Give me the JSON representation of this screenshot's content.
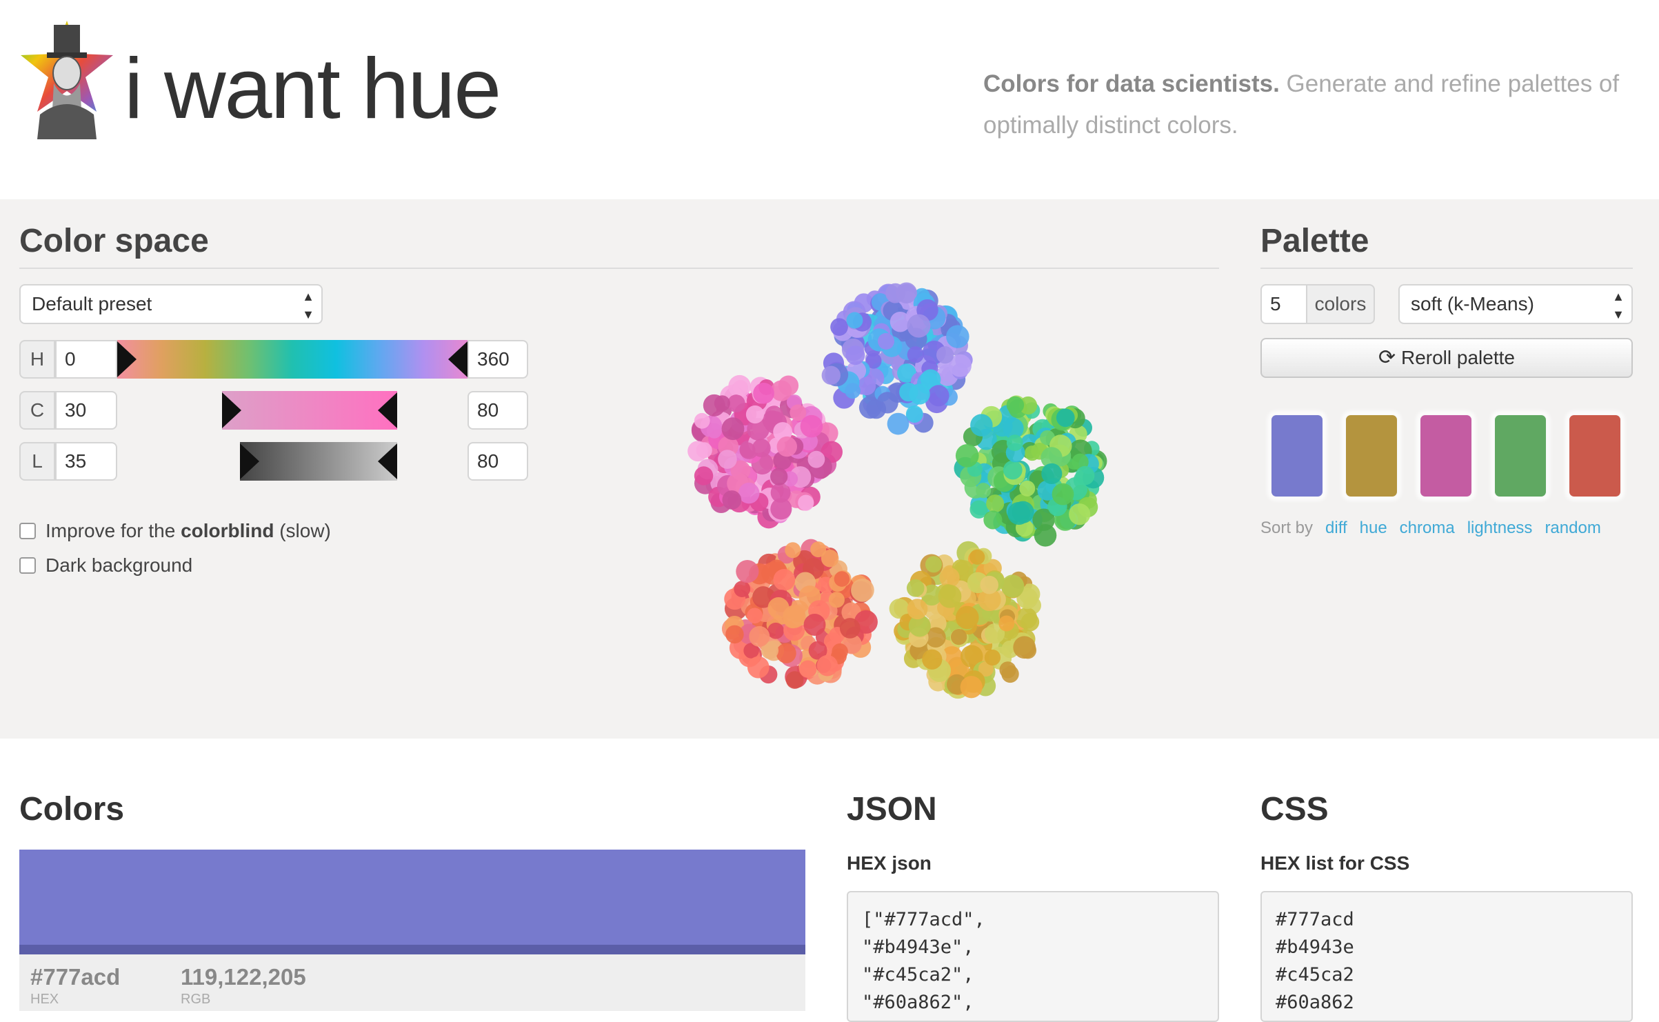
{
  "header": {
    "title": "i want hue",
    "tagline_bold": "Colors for data scientists.",
    "tagline_rest": " Generate and refine palettes of optimally distinct colors."
  },
  "color_space": {
    "title": "Color space",
    "preset": "Default preset",
    "hue": {
      "label": "H",
      "min": "0",
      "max": "360"
    },
    "chroma": {
      "label": "C",
      "min": "30",
      "max": "80"
    },
    "lightness": {
      "label": "L",
      "min": "35",
      "max": "80"
    },
    "colorblind_pre": "Improve for the ",
    "colorblind_bold": "colorblind",
    "colorblind_post": " (slow)",
    "dark_bg": "Dark background"
  },
  "palette": {
    "title": "Palette",
    "count": "5",
    "count_unit": "colors",
    "algorithm": "soft (k-Means)",
    "reroll": "Reroll palette",
    "swatches": [
      "#777acd",
      "#b4943e",
      "#c45ca2",
      "#60a862",
      "#cb5a4c"
    ],
    "sort_label": "Sort by",
    "sort_options": [
      "diff",
      "hue",
      "chroma",
      "lightness",
      "random"
    ]
  },
  "colors": {
    "title": "Colors",
    "first_hex": "#777acd",
    "first_hex_label": "HEX",
    "first_rgb": "119,122,205",
    "first_rgb_label": "RGB"
  },
  "json": {
    "title": "JSON",
    "subtitle": "HEX json",
    "code": "[\"#777acd\",\n\"#b4943e\",\n\"#c45ca2\",\n\"#60a862\","
  },
  "css": {
    "title": "CSS",
    "subtitle": "HEX list for CSS",
    "code": "#777acd\n#b4943e\n#c45ca2\n#60a862"
  }
}
